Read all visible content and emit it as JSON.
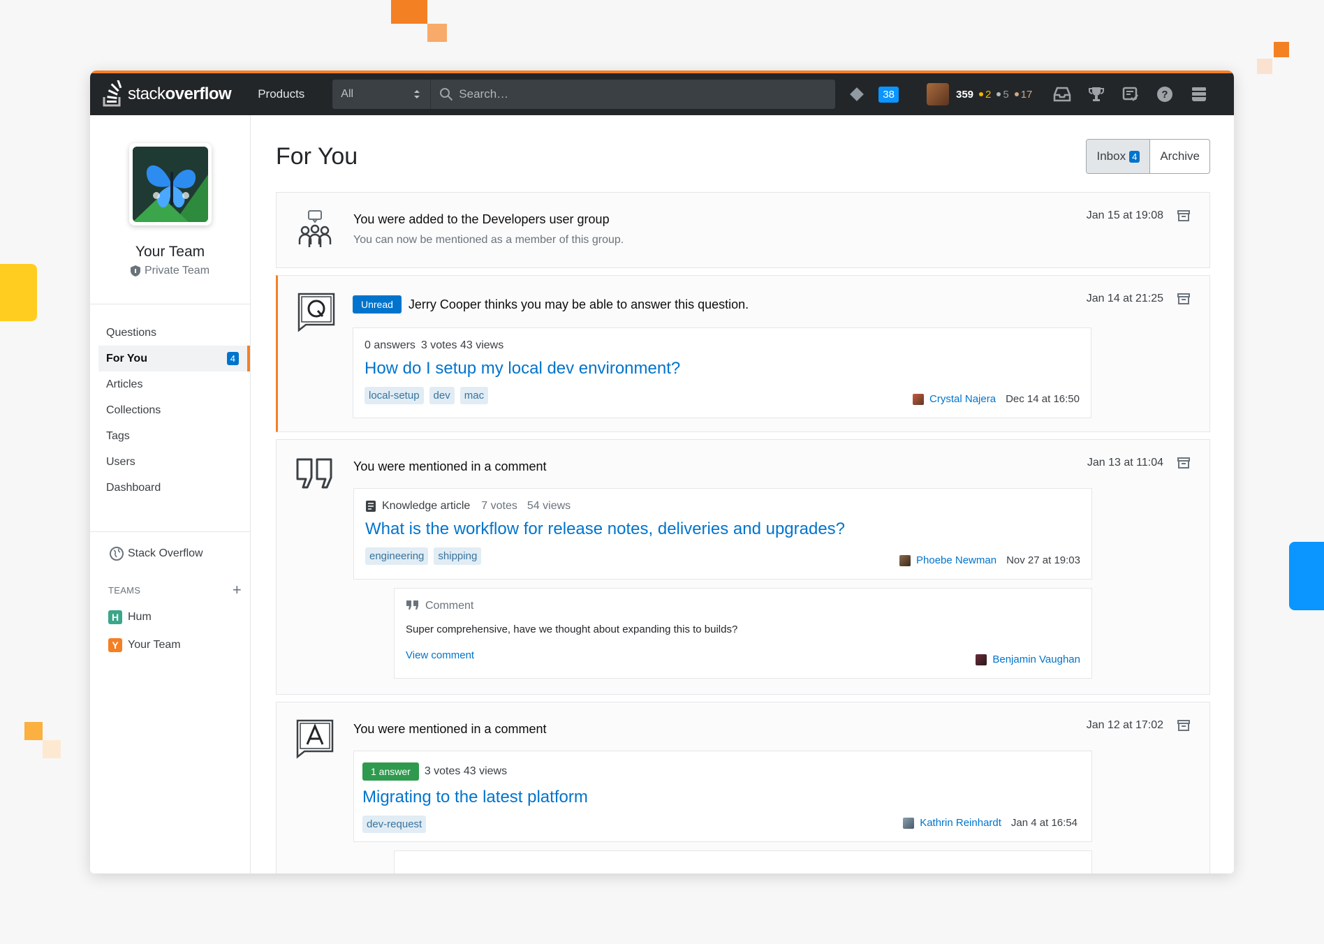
{
  "colors": {
    "brand": "#f48024",
    "link": "#0074cc",
    "topbar": "#232629"
  },
  "topbar": {
    "logo_light": "stack",
    "logo_bold": "overflow",
    "products": "Products",
    "scope": "All",
    "search_placeholder": "Search…",
    "inbox_count": "38",
    "reputation": "359",
    "gold": "2",
    "silver": "5",
    "bronze": "17"
  },
  "sidebar": {
    "team_name": "Your Team",
    "team_type": "Private Team",
    "nav": [
      {
        "label": "Questions"
      },
      {
        "label": "For You",
        "badge": "4"
      },
      {
        "label": "Articles"
      },
      {
        "label": "Collections"
      },
      {
        "label": "Tags"
      },
      {
        "label": "Users"
      },
      {
        "label": "Dashboard"
      }
    ],
    "public_link": "Stack Overflow",
    "teams_heading": "TEAMS",
    "teams": [
      {
        "letter": "H",
        "name": "Hum",
        "color": "#3ba68a"
      },
      {
        "letter": "Y",
        "name": "Your Team",
        "color": "#f48024"
      }
    ]
  },
  "main": {
    "title": "For You",
    "inbox_label": "Inbox",
    "inbox_count": "4",
    "archive_label": "Archive",
    "notifications": [
      {
        "title": "You were added to the Developers user group",
        "subtitle": "You can now be mentioned as a member of this group.",
        "time": "Jan 15 at 19:08"
      },
      {
        "unread_label": "Unread",
        "title": "Jerry Cooper thinks you may be able to answer this question.",
        "time": "Jan 14 at 21:25",
        "post": {
          "answers": "0 answers",
          "stats": "3 votes 43 views",
          "title": "How do I setup my local dev environment?",
          "tags": [
            "local-setup",
            "dev",
            "mac"
          ],
          "author": "Crystal Najera",
          "date": "Dec 14 at 16:50"
        }
      },
      {
        "title": "You were mentioned in a comment",
        "time": "Jan 13 at 11:04",
        "post": {
          "kind": "Knowledge article",
          "votes": "7 votes",
          "views": "54 views",
          "title": "What is the workflow for release notes, deliveries and upgrades?",
          "tags": [
            "engineering",
            "shipping"
          ],
          "author": "Phoebe Newman",
          "date": "Nov 27 at 19:03"
        },
        "comment": {
          "label": "Comment",
          "text": "Super comprehensive, have we thought about expanding this to builds?",
          "link": "View comment",
          "author": "Benjamin Vaughan"
        }
      },
      {
        "title": "You were mentioned in a comment",
        "time": "Jan 12 at 17:02",
        "post": {
          "answers": "1 answer",
          "stats": "3 votes 43 views",
          "title": "Migrating to the latest platform",
          "tags": [
            "dev-request"
          ],
          "author": "Kathrin Reinhardt",
          "date": "Jan 4 at 16:54"
        }
      }
    ]
  }
}
